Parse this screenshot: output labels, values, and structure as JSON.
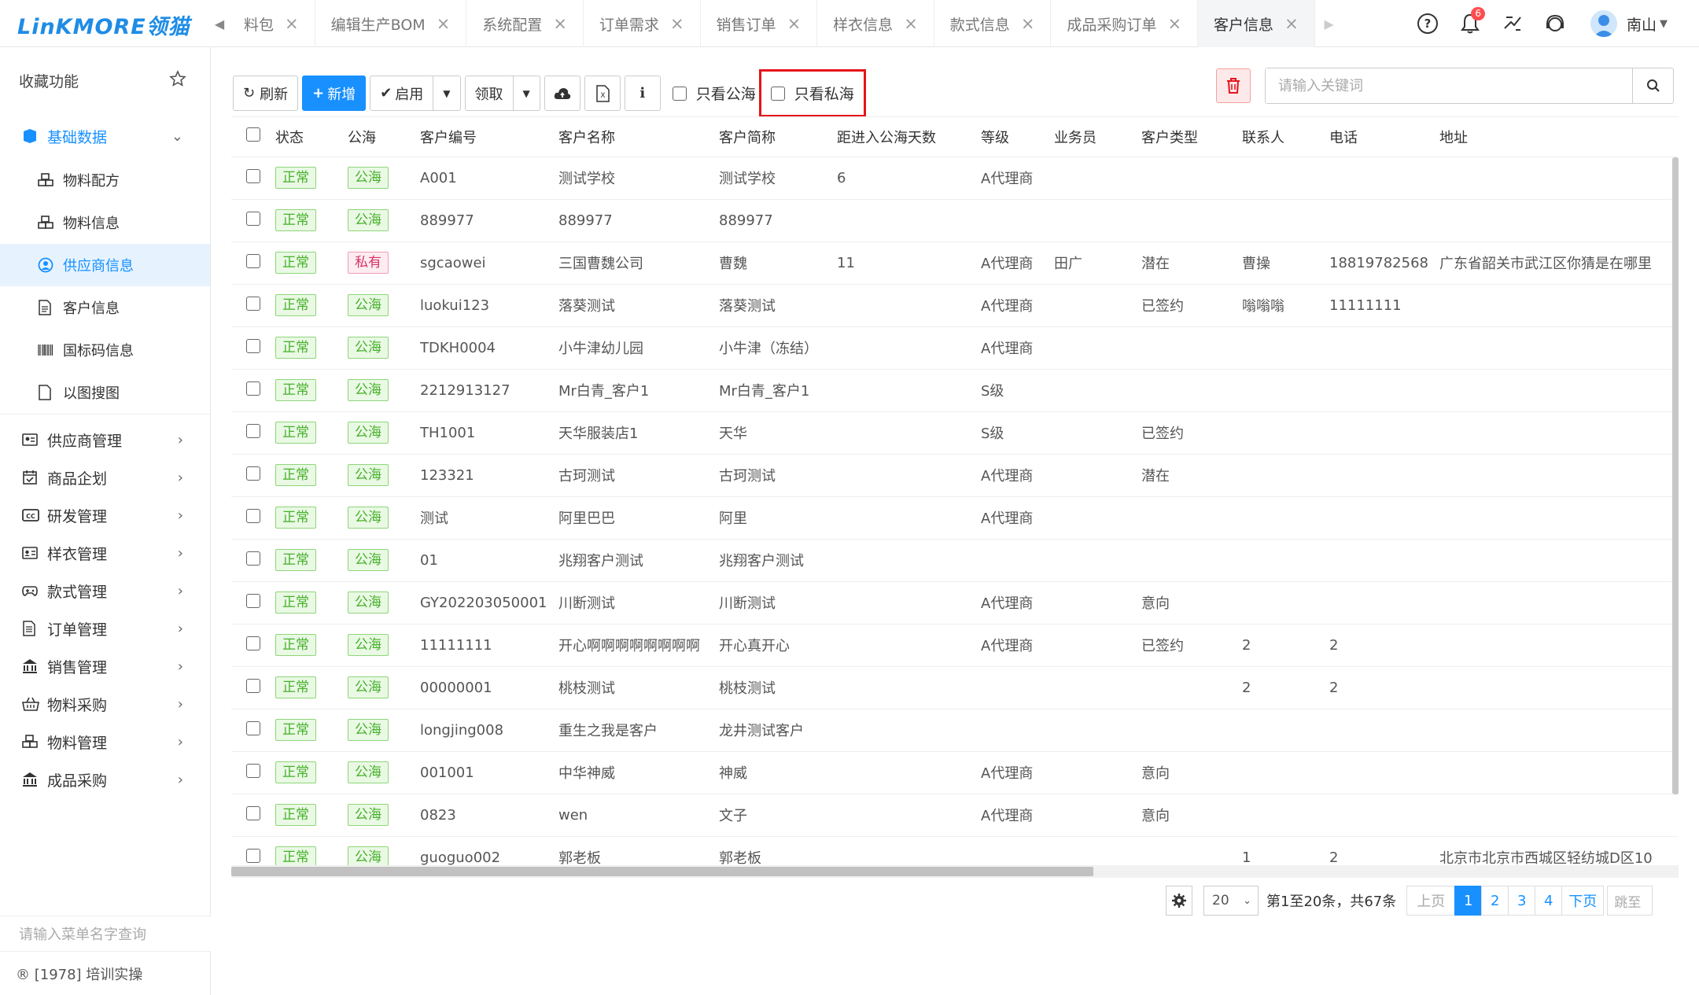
{
  "brand": {
    "logo_text": "LinKMORE领猫"
  },
  "tabs": [
    {
      "label": "料包",
      "active": false
    },
    {
      "label": "编辑生产BOM",
      "active": false
    },
    {
      "label": "系统配置",
      "active": false
    },
    {
      "label": "订单需求",
      "active": false
    },
    {
      "label": "销售订单",
      "active": false
    },
    {
      "label": "样衣信息",
      "active": false
    },
    {
      "label": "款式信息",
      "active": false
    },
    {
      "label": "成品采购订单",
      "active": false
    },
    {
      "label": "客户信息",
      "active": true
    }
  ],
  "header": {
    "notification_count": "6",
    "user_name": "南山"
  },
  "sidebar": {
    "favorites_label": "收藏功能",
    "open_group": "基础数据",
    "sub_items": [
      {
        "label": "物料配方",
        "icon": "cubes-icon"
      },
      {
        "label": "物料信息",
        "icon": "cubes-icon"
      },
      {
        "label": "供应商信息",
        "icon": "user-circle-icon",
        "active": true
      },
      {
        "label": "客户信息",
        "icon": "document-icon"
      },
      {
        "label": "国标码信息",
        "icon": "barcode-icon"
      },
      {
        "label": "以图搜图",
        "icon": "file-icon"
      }
    ],
    "groups": [
      {
        "label": "供应商管理",
        "icon": "id-card-icon"
      },
      {
        "label": "商品企划",
        "icon": "calendar-check-icon"
      },
      {
        "label": "研发管理",
        "icon": "cc-icon"
      },
      {
        "label": "样衣管理",
        "icon": "address-card-icon"
      },
      {
        "label": "款式管理",
        "icon": "gamepad-icon"
      },
      {
        "label": "订单管理",
        "icon": "list-doc-icon"
      },
      {
        "label": "销售管理",
        "icon": "bank-icon"
      },
      {
        "label": "物料采购",
        "icon": "basket-icon"
      },
      {
        "label": "物料管理",
        "icon": "cubes-icon"
      },
      {
        "label": "成品采购",
        "icon": "bank-icon"
      }
    ],
    "search_placeholder": "请输入菜单名字查询",
    "footer": "® [1978] 培训实操"
  },
  "toolbar": {
    "refresh": "刷新",
    "add": "新增",
    "enable": "启用",
    "claim": "领取",
    "only_public": "只看公海",
    "only_private": "只看私海",
    "search_placeholder": "请输入关键词"
  },
  "table": {
    "columns": [
      "状态",
      "公海",
      "客户编号",
      "客户名称",
      "客户简称",
      "距进入公海天数",
      "等级",
      "业务员",
      "客户类型",
      "联系人",
      "电话",
      "地址"
    ],
    "rows": [
      [
        "正常",
        "公海",
        "A001",
        "测试学校",
        "测试学校",
        "6",
        "A代理商",
        "",
        "",
        "",
        "",
        ""
      ],
      [
        "正常",
        "公海",
        "889977",
        "889977",
        "889977",
        "",
        "",
        "",
        "",
        "",
        "",
        ""
      ],
      [
        "正常",
        "私有",
        "sgcaowei",
        "三国曹魏公司",
        "曹魏",
        "11",
        "A代理商",
        "田广",
        "潜在",
        "曹操",
        "18819782568",
        "广东省韶关市武江区你猜是在哪里"
      ],
      [
        "正常",
        "公海",
        "luokui123",
        "落葵测试",
        "落葵测试",
        "",
        "A代理商",
        "",
        "已签约",
        "嗡嗡嗡",
        "11111111",
        ""
      ],
      [
        "正常",
        "公海",
        "TDKH0004",
        "小牛津幼儿园",
        "小牛津（冻结）",
        "",
        "A代理商",
        "",
        "",
        "",
        "",
        ""
      ],
      [
        "正常",
        "公海",
        "2212913127",
        "Mr白青_客户1",
        "Mr白青_客户1",
        "",
        "S级",
        "",
        "",
        "",
        "",
        ""
      ],
      [
        "正常",
        "公海",
        "TH1001",
        "天华服装店1",
        "天华",
        "",
        "S级",
        "",
        "已签约",
        "",
        "",
        ""
      ],
      [
        "正常",
        "公海",
        "123321",
        "古珂测试",
        "古珂测试",
        "",
        "A代理商",
        "",
        "潜在",
        "",
        "",
        ""
      ],
      [
        "正常",
        "公海",
        "测试",
        "阿里巴巴",
        "阿里",
        "",
        "A代理商",
        "",
        "",
        "",
        "",
        ""
      ],
      [
        "正常",
        "公海",
        "01",
        "兆翔客户测试",
        "兆翔客户测试",
        "",
        "",
        "",
        "",
        "",
        "",
        ""
      ],
      [
        "正常",
        "公海",
        "GY202203050001",
        "川断测试",
        "川断测试",
        "",
        "A代理商",
        "",
        "意向",
        "",
        "",
        ""
      ],
      [
        "正常",
        "公海",
        "11111111",
        "开心啊啊啊啊啊啊啊啊",
        "开心真开心",
        "",
        "A代理商",
        "",
        "已签约",
        "2",
        "2",
        ""
      ],
      [
        "正常",
        "公海",
        "00000001",
        "桃枝测试",
        "桃枝测试",
        "",
        "",
        "",
        "",
        "2",
        "2",
        ""
      ],
      [
        "正常",
        "公海",
        "longjing008",
        "重生之我是客户",
        "龙井测试客户",
        "",
        "",
        "",
        "",
        "",
        "",
        ""
      ],
      [
        "正常",
        "公海",
        "001001",
        "中华神威",
        "神威",
        "",
        "A代理商",
        "",
        "意向",
        "",
        "",
        ""
      ],
      [
        "正常",
        "公海",
        "0823",
        "wen",
        "文子",
        "",
        "A代理商",
        "",
        "意向",
        "",
        "",
        ""
      ],
      [
        "正常",
        "公海",
        "guoguo002",
        "郭老板",
        "郭老板",
        "",
        "",
        "",
        "",
        "1",
        "2",
        "北京市北京市西城区轻纺城D区10"
      ]
    ]
  },
  "pagination": {
    "page_size": "20",
    "info": "第1至20条，共67条",
    "prev": "上页",
    "pages": [
      "1",
      "2",
      "3",
      "4"
    ],
    "current": "1",
    "next": "下页",
    "jump_placeholder": "跳至"
  },
  "colors": {
    "accent": "#1890ff",
    "tag_green": "#46b02a",
    "tag_pink": "#d6336c",
    "highlight_box": "#e5141b"
  }
}
